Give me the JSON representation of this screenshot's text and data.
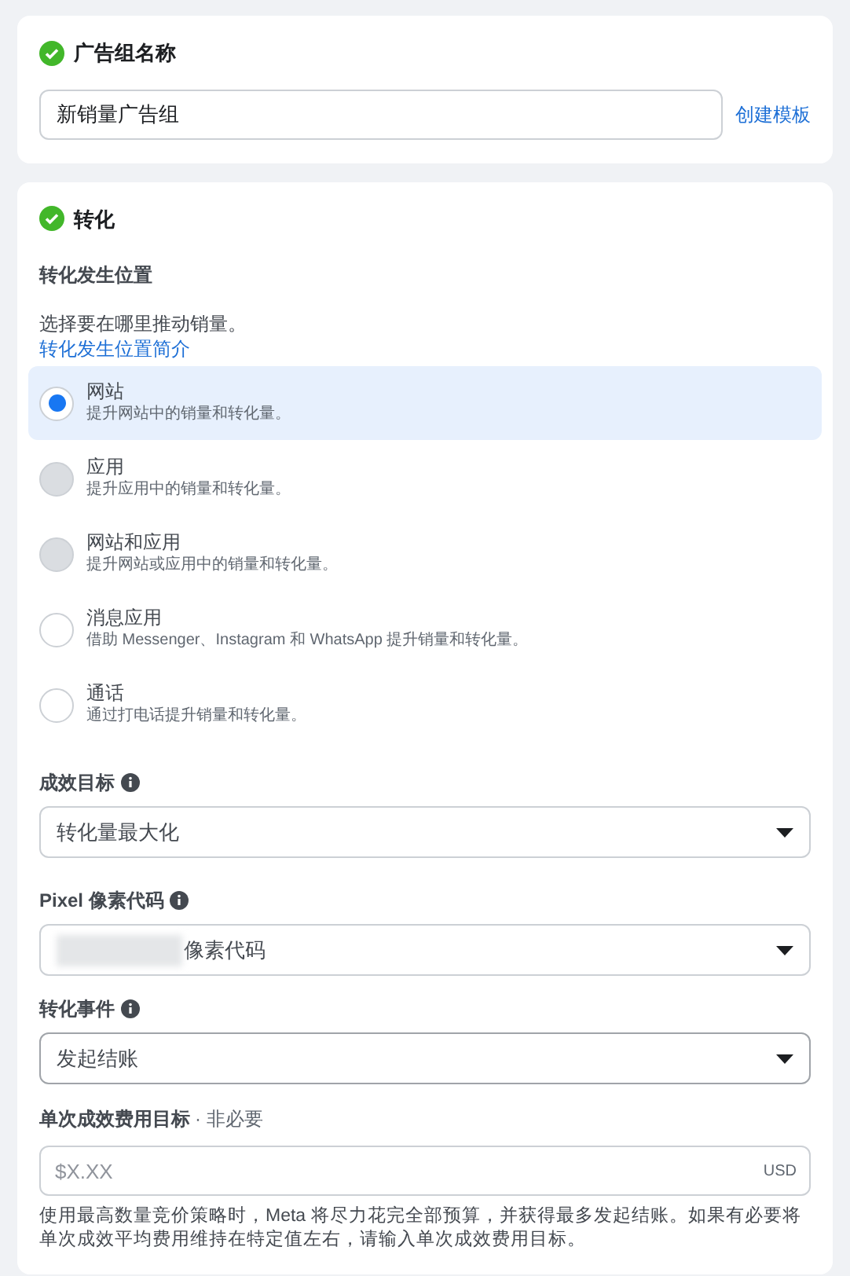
{
  "ad_set_name": {
    "title": "广告组名称",
    "complete": true,
    "value": "新销量广告组",
    "link": "创建模板"
  },
  "conversion": {
    "title": "转化",
    "complete": true,
    "location_label": "转化发生位置",
    "description": "选择要在哪里推动销量。",
    "link": "转化发生位置简介",
    "options": [
      {
        "label": "网站",
        "description": "提升网站中的销量和转化量。",
        "selected": true,
        "disabled": false
      },
      {
        "label": "应用",
        "description": "提升应用中的销量和转化量。",
        "selected": false,
        "disabled": true
      },
      {
        "label": "网站和应用",
        "description": "提升网站或应用中的销量和转化量。",
        "selected": false,
        "disabled": true
      },
      {
        "label": "消息应用",
        "description": "借助 Messenger、Instagram 和 WhatsApp 提升销量和转化量。",
        "selected": false,
        "disabled": false
      },
      {
        "label": "通话",
        "description": "通过打电话提升销量和转化量。",
        "selected": false,
        "disabled": false
      }
    ],
    "selects": [
      {
        "label": "成效目标",
        "value": "转化量最大化",
        "redacted": false
      },
      {
        "label": "Pixel 像素代码",
        "value": "像素代码",
        "redacted": true
      },
      {
        "label": "转化事件",
        "value": "发起结账",
        "redacted": false
      }
    ],
    "cost_goal": {
      "label": "单次成效费用目标",
      "optional": "· 非必要",
      "placeholder": "$X.XX",
      "currency": "USD",
      "help": "使用最高数量竞价策略时，Meta 将尽力花完全部预算，并获得最多发起结账。如果有必要将单次成效平均费用维持在特定值左右，请输入单次成效费用目标。"
    }
  }
}
